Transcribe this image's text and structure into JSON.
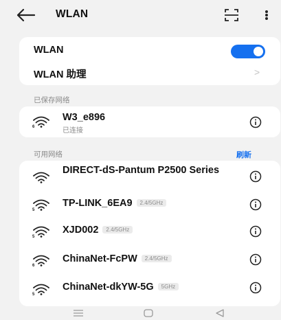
{
  "header": {
    "title": "WLAN",
    "back_icon": "back-arrow-icon",
    "scan_icon": "scan-qr-icon",
    "more_icon": "more-vertical-icon"
  },
  "settings": {
    "wlan_label": "WLAN",
    "wlan_enabled": true,
    "assistant_label": "WLAN 助理",
    "assistant_chevron": ">"
  },
  "saved": {
    "section_title": "已保存网络",
    "networks": [
      {
        "name": "W3_e896",
        "status": "已连接"
      }
    ]
  },
  "available": {
    "section_title": "可用网络",
    "refresh_label": "刷新",
    "networks": [
      {
        "name": "DIRECT-dS-Pantum P2500 Series",
        "band": ""
      },
      {
        "name": "TP-LINK_6EA9",
        "band": "2.4/5GHz"
      },
      {
        "name": "XJD002",
        "band": "2.4/5GHz"
      },
      {
        "name": "ChinaNet-FcPW",
        "band": "2.4/5GHz"
      },
      {
        "name": "ChinaNet-dkYW-5G",
        "band": "5GHz"
      }
    ]
  },
  "colors": {
    "accent": "#1570ef",
    "background": "#f2f2f2",
    "card": "#ffffff",
    "secondary_text": "#8a8a8a"
  },
  "navbar": {
    "icons": [
      "menu-icon",
      "home-icon",
      "back-triangle-icon"
    ]
  }
}
